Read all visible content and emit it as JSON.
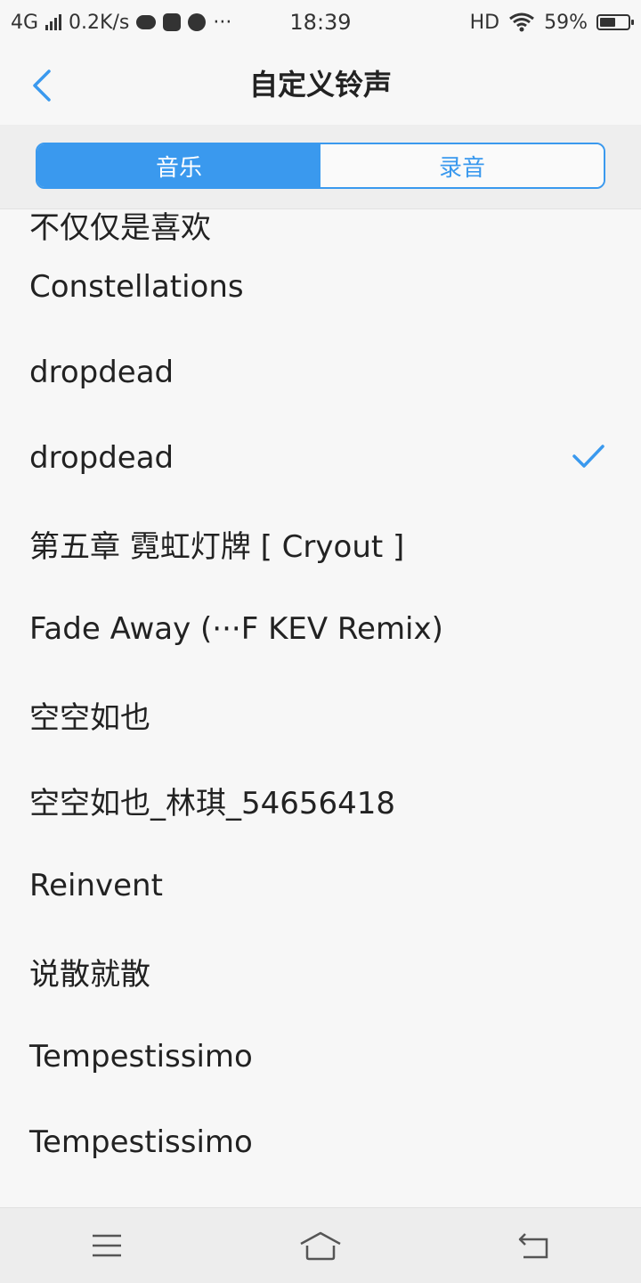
{
  "status_bar": {
    "network": "4G",
    "speed": "0.2K/s",
    "more": "···",
    "time": "18:39",
    "hd": "HD",
    "battery": "59%",
    "battery_level": 0.59
  },
  "header": {
    "title": "自定义铃声",
    "back_icon": "chevron-left-icon"
  },
  "tabs": [
    {
      "label": "音乐",
      "active": true
    },
    {
      "label": "录音",
      "active": false
    }
  ],
  "ringtones": [
    {
      "title": "不仅仅是喜欢",
      "selected": false
    },
    {
      "title": "Constellations",
      "selected": false
    },
    {
      "title": "dropdead",
      "selected": false
    },
    {
      "title": "dropdead",
      "selected": true
    },
    {
      "title": "第五章 霓虹灯牌 [ Cryout ]",
      "selected": false
    },
    {
      "title": "Fade Away (···F KEV Remix)",
      "selected": false
    },
    {
      "title": "空空如也",
      "selected": false
    },
    {
      "title": "空空如也_林琪_54656418",
      "selected": false
    },
    {
      "title": "Reinvent",
      "selected": false
    },
    {
      "title": "说散就散",
      "selected": false
    },
    {
      "title": "Tempestissimo",
      "selected": false
    },
    {
      "title": "Tempestissimo",
      "selected": false
    }
  ],
  "colors": {
    "accent": "#3a99ee",
    "background": "#f7f7f7",
    "text": "#222222"
  }
}
